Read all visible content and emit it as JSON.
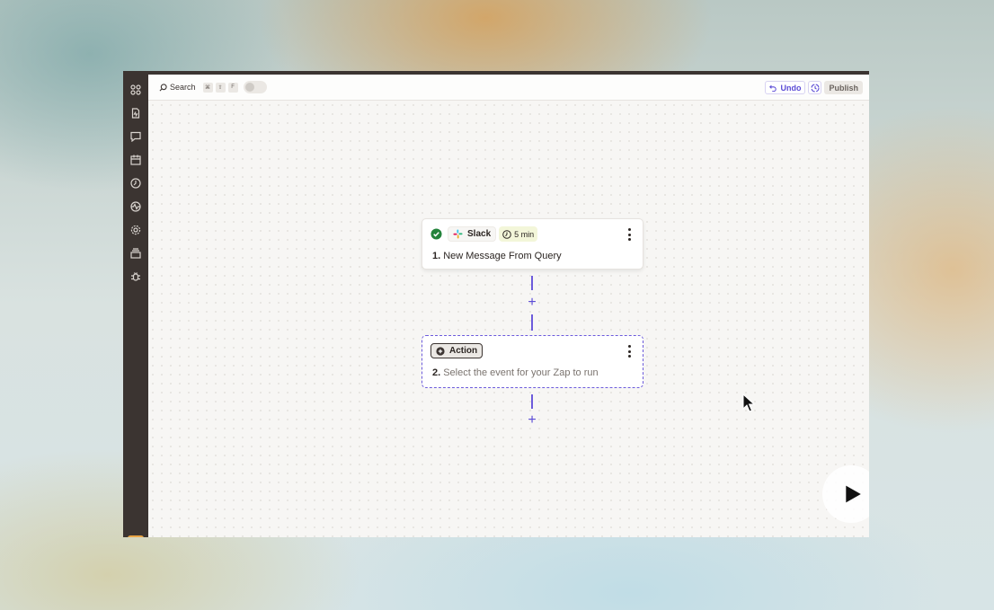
{
  "topbar": {
    "search_label": "Search",
    "shortcut_keys": [
      "⌘",
      "⇧",
      "F"
    ],
    "undo_label": "Undo",
    "publish_label": "Publish"
  },
  "sidebar": {
    "icons": [
      "apps-icon",
      "zap-file-icon",
      "chat-icon",
      "calendar-icon",
      "history-icon",
      "activity-icon",
      "settings-icon",
      "stack-icon",
      "bug-icon"
    ]
  },
  "steps": [
    {
      "number": "1.",
      "app": "Slack",
      "status": "complete",
      "interval": "5 min",
      "title": "New Message From Query"
    },
    {
      "number": "2.",
      "app": "Action",
      "title": "Select the event for your Zap to run"
    }
  ],
  "connectors": {
    "plus": "+"
  },
  "colors": {
    "accent": "#5b4bd6",
    "sidebar": "#3b3431",
    "success": "#23833b",
    "canvas": "#f7f6f4"
  }
}
